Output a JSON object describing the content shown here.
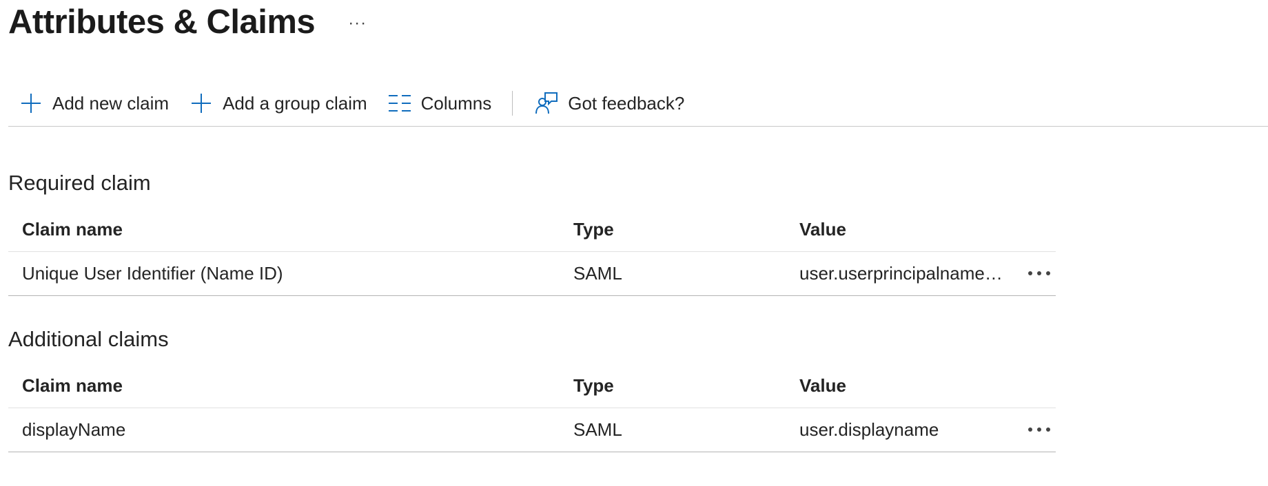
{
  "page": {
    "title": "Attributes & Claims",
    "more_label": "···"
  },
  "toolbar": {
    "add_claim_label": "Add new claim",
    "add_group_claim_label": "Add a group claim",
    "columns_label": "Columns",
    "feedback_label": "Got feedback?",
    "accent_color": "#0f6cbd"
  },
  "required": {
    "title": "Required claim",
    "columns": [
      "Claim name",
      "Type",
      "Value"
    ],
    "rows": [
      {
        "name": "Unique User Identifier (Name ID)",
        "type": "SAML",
        "value": "user.userprincipalname [..."
      }
    ]
  },
  "additional": {
    "title": "Additional claims",
    "columns": [
      "Claim name",
      "Type",
      "Value"
    ],
    "rows": [
      {
        "name": "displayName",
        "type": "SAML",
        "value": "user.displayname"
      }
    ]
  }
}
